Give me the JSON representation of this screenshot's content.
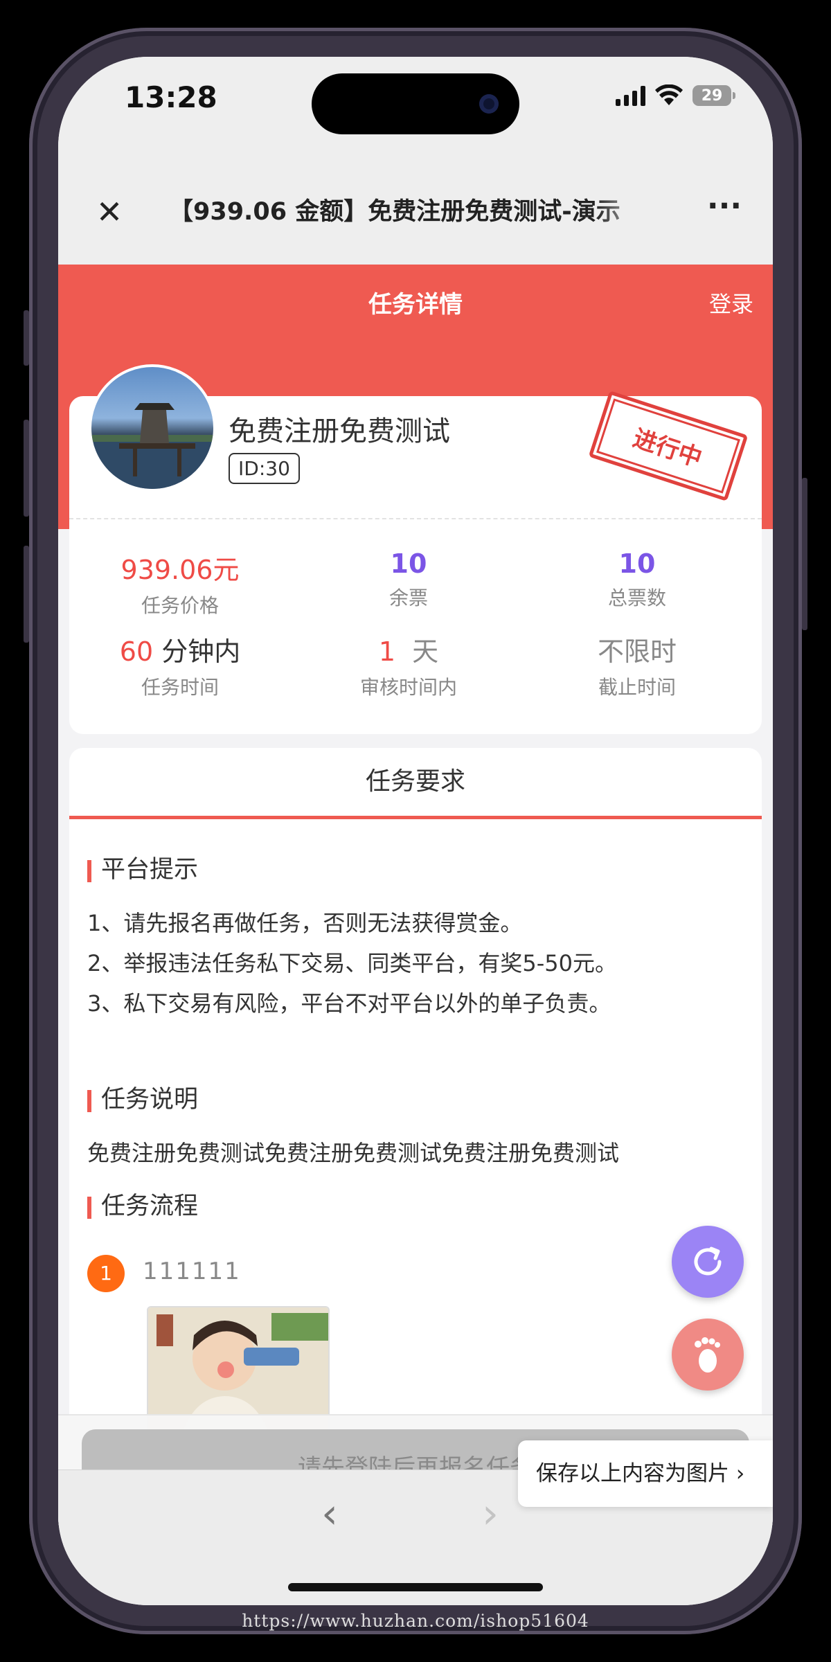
{
  "status_bar": {
    "time": "13:28",
    "battery": "29"
  },
  "title_bar": {
    "title": "【939.06 金额】免费注册免费测试-演示"
  },
  "header": {
    "title": "任务详情",
    "login_label": "登录"
  },
  "task": {
    "name": "免费注册免费测试",
    "id_label": "ID:30",
    "stamp_label": "进行中",
    "stats": {
      "price_value": "939.06元",
      "price_label": "任务价格",
      "remaining_value": "10",
      "remaining_label": "余票",
      "total_value": "10",
      "total_label": "总票数",
      "duration_num": "60",
      "duration_unit": "分钟内",
      "duration_label": "任务时间",
      "review_num": "1",
      "review_unit": "天",
      "review_label": "审核时间内",
      "deadline_value": "不限时",
      "deadline_label": "截止时间"
    }
  },
  "requirements": {
    "title": "任务要求",
    "platform_tip_title": "平台提示",
    "platform_tips": [
      "1、请先报名再做任务，否则无法获得赏金。",
      "2、举报违法任务私下交易、同类平台，有奖5-50元。",
      "3、私下交易有风险，平台不对平台以外的单子负责。"
    ],
    "description_title": "任务说明",
    "description": "免费注册免费测试免费注册免费测试免费注册免费测试",
    "process_title": "任务流程",
    "steps": [
      {
        "number": "1",
        "text": "111111"
      }
    ]
  },
  "actions": {
    "enroll_button": "请先登陆后再报名任务",
    "save_image": "保存以上内容为图片 ›"
  },
  "colors": {
    "accent": "#ef5a51",
    "purple": "#7b55e6",
    "orange": "#ff6a13"
  },
  "watermark": "https://www.huzhan.com/ishop51604"
}
